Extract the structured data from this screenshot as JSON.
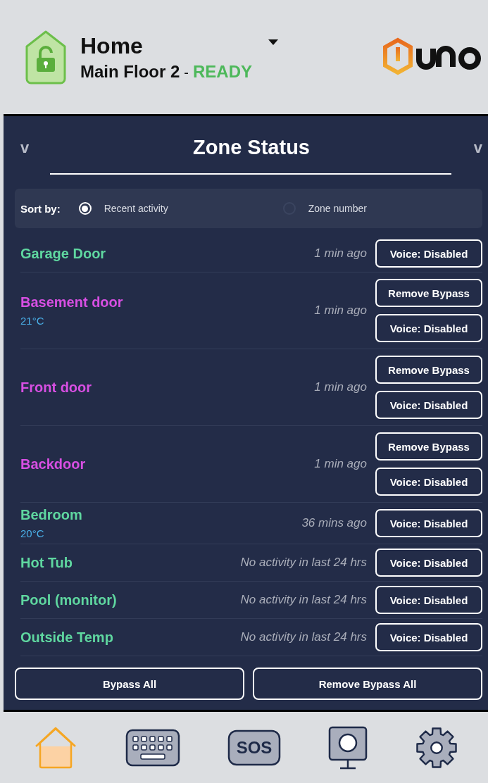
{
  "header": {
    "location": "Home",
    "partition": "Main Floor 2",
    "separator": "-",
    "status": "READY",
    "locked": false
  },
  "panel": {
    "title": "Zone Status",
    "left_toggle": "v",
    "right_toggle": "v"
  },
  "sort": {
    "label": "Sort by:",
    "options": [
      {
        "label": "Recent activity",
        "selected": true
      },
      {
        "label": "Zone number",
        "selected": false
      }
    ]
  },
  "zones": [
    {
      "name": "Garage Door",
      "color": "#5fd7a0",
      "time": "1 min ago",
      "buttons": [
        "Voice: Disabled"
      ]
    },
    {
      "name": "Basement door",
      "color": "#d84fe3",
      "temp": "21°C",
      "time": "1 min ago",
      "buttons": [
        "Remove Bypass",
        "Voice: Disabled"
      ]
    },
    {
      "name": "Front door",
      "color": "#d84fe3",
      "time": "1 min ago",
      "buttons": [
        "Remove Bypass",
        "Voice: Disabled"
      ]
    },
    {
      "name": "Backdoor",
      "color": "#d84fe3",
      "time": "1 min ago",
      "buttons": [
        "Remove Bypass",
        "Voice: Disabled"
      ]
    },
    {
      "name": "Bedroom",
      "color": "#5fd7a0",
      "temp": "20°C",
      "time": "36 mins ago",
      "buttons": [
        "Voice: Disabled"
      ]
    },
    {
      "name": "Hot Tub",
      "color": "#5fd7a0",
      "time": "No activity in last 24 hrs",
      "buttons": [
        "Voice: Disabled"
      ]
    },
    {
      "name": "Pool (monitor)",
      "color": "#5fd7a0",
      "time": "No activity in last 24 hrs",
      "buttons": [
        "Voice: Disabled"
      ]
    },
    {
      "name": "Outside Temp",
      "color": "#5fd7a0",
      "time": "No activity in last 24 hrs",
      "buttons": [
        "Voice: Disabled"
      ]
    }
  ],
  "actions": [
    "Bypass All",
    "Remove Bypass All"
  ],
  "nav": [
    {
      "kind": "home",
      "selected": true
    },
    {
      "kind": "keypad",
      "selected": false
    },
    {
      "kind": "sos",
      "label": "SOS",
      "selected": false
    },
    {
      "kind": "camera",
      "selected": false
    },
    {
      "kind": "settings",
      "selected": false
    }
  ]
}
